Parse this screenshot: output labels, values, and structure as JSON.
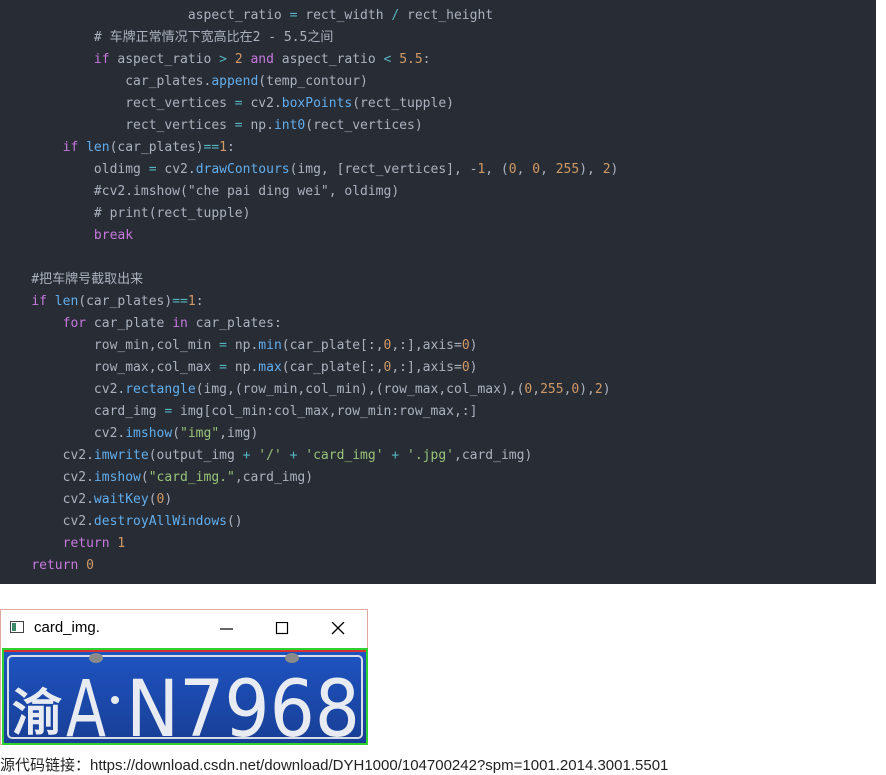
{
  "code": {
    "lines": [
      "            aspect_ratio = rect_width / rect_height",
      "            # 车牌正常情况下宽高比在2 - 5.5之间",
      "            if aspect_ratio > 2 and aspect_ratio < 5.5:",
      "                car_plates.append(temp_contour)",
      "                rect_vertices = cv2.boxPoints(rect_tupple)",
      "                rect_vertices = np.int0(rect_vertices)",
      "        if len(car_plates)==1:",
      "            oldimg = cv2.drawContours(img, [rect_vertices], -1, (0, 0, 255), 2)",
      "            #cv2.imshow(\"che pai ding wei\", oldimg)",
      "            # print(rect_tupple)",
      "            break",
      "",
      "    #把车牌号截取出来",
      "    if len(car_plates)==1:",
      "        for car_plate in car_plates:",
      "            row_min,col_min = np.min(car_plate[:,0,:],axis=0)",
      "            row_max,col_max = np.max(car_plate[:,0,:],axis=0)",
      "            cv2.rectangle(img,(row_min,col_min),(row_max,col_max),(0,255,0),2)",
      "            card_img = img[col_min:col_max,row_min:row_max,:]",
      "            cv2.imshow(\"img\",img)",
      "        cv2.imwrite(output_img + '/' + 'card_img' + '.jpg',card_img)",
      "        cv2.imshow(\"card_img.\",card_img)",
      "        cv2.waitKey(0)",
      "        cv2.destroyAllWindows()",
      "        return 1",
      "    return 0"
    ]
  },
  "window": {
    "title": "card_img.",
    "minimize_icon": "minimize-icon",
    "maximize_icon": "maximize-icon",
    "close_icon": "close-icon"
  },
  "plate": {
    "text": "渝A N7968",
    "province": "渝",
    "letter": "A",
    "number": "N7968",
    "background_color": "#1d4fb8",
    "text_color": "#e8ecf2",
    "border_color": "#2fd12f"
  },
  "footer": {
    "text": "源代码链接：https://download.csdn.net/download/DYH1000/104700242?spm=1001.2014.3001.5501"
  }
}
